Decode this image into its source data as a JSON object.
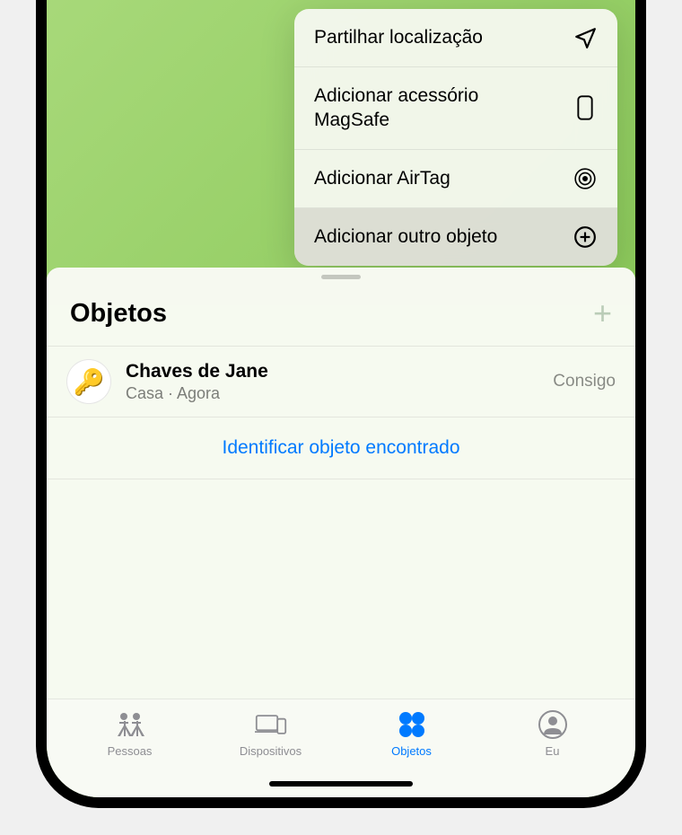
{
  "popup": {
    "items": [
      {
        "label": "Partilhar localização",
        "icon": "location-arrow"
      },
      {
        "label": "Adicionar acessório MagSafe",
        "icon": "phone-outline"
      },
      {
        "label": "Adicionar AirTag",
        "icon": "airtag"
      },
      {
        "label": "Adicionar outro objeto",
        "icon": "plus-circle"
      }
    ]
  },
  "sheet": {
    "title": "Objetos",
    "item": {
      "name": "Chaves de Jane",
      "location": "Casa · Agora",
      "status": "Consigo"
    },
    "identify_link": "Identificar objeto encontrado"
  },
  "tabs": [
    {
      "label": "Pessoas",
      "icon": "people"
    },
    {
      "label": "Dispositivos",
      "icon": "devices"
    },
    {
      "label": "Objetos",
      "icon": "grid",
      "active": true
    },
    {
      "label": "Eu",
      "icon": "person"
    }
  ]
}
